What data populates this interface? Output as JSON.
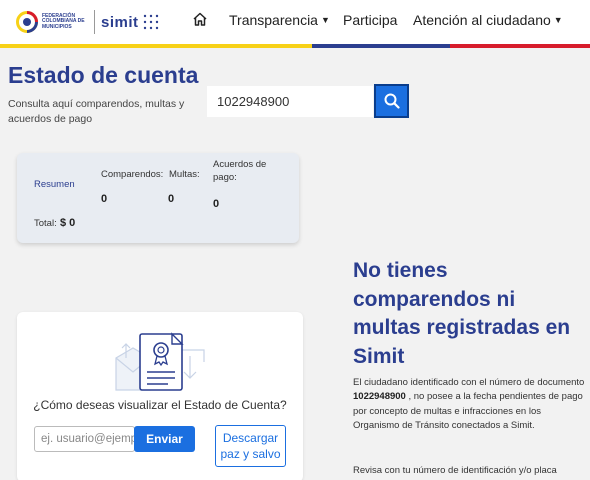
{
  "header": {
    "logo": {
      "federation_text": "FEDERACIÓN COLOMBIANA DE MUNICIPIOS",
      "brand": "simit"
    },
    "nav": [
      {
        "label": "Transparencia",
        "has_dropdown": true
      },
      {
        "label": "Participa",
        "has_dropdown": false
      },
      {
        "label": "Atención al ciudadano",
        "has_dropdown": true
      }
    ],
    "stripe_colors": [
      "#f7d117",
      "#2b3e8f",
      "#d71c2b"
    ]
  },
  "page": {
    "title": "Estado de cuenta",
    "subtitle": "Consulta aquí comparendos, multas y acuerdos de pago"
  },
  "search": {
    "value": "1022948900"
  },
  "summary": {
    "resumen_label": "Resumen",
    "comparendos_label": "Comparendos:",
    "comparendos_value": "0",
    "multas_label": "Multas:",
    "multas_value": "0",
    "acuerdos_label": "Acuerdos de pago:",
    "acuerdos_value": "0",
    "total_label": "Total:",
    "total_value": "$ 0"
  },
  "visualizar": {
    "question": "¿Cómo deseas visualizar el Estado de Cuenta?",
    "email_placeholder": "ej. usuario@ejemplo.com",
    "enviar_label": "Enviar",
    "descargar_label": "Descargar paz y salvo"
  },
  "result": {
    "title": "No tienes comparendos ni multas registradas en Simit",
    "text_before": "El ciudadano identificado con el número de documento",
    "document": "1022948900",
    "text_after": ", no posee a la fecha pendientes de pago por concepto de multas e infracciones en los Organismo de Tránsito conectados a Simit.",
    "text2": "Revisa con tu número de identificación y/o placa"
  },
  "colors": {
    "primary": "#2b3e8f",
    "accent": "#1b6fe0"
  }
}
